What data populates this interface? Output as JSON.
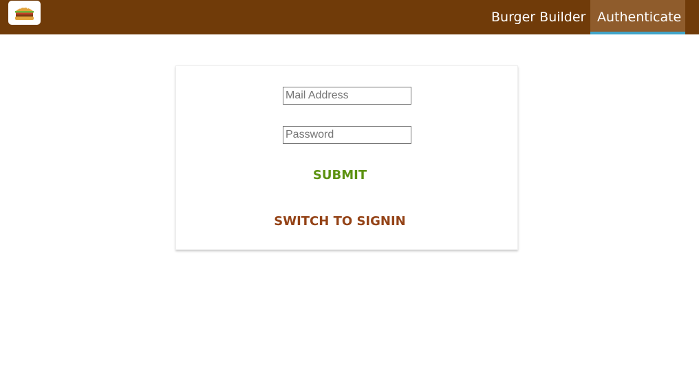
{
  "header": {
    "logo_icon": "burger-icon",
    "nav": {
      "builder_label": "Burger Builder",
      "auth_label": "Authenticate"
    }
  },
  "auth_form": {
    "email_placeholder": "Mail Address",
    "email_value": "",
    "password_placeholder": "Password",
    "password_value": "",
    "submit_label": "SUBMIT",
    "switch_label": "SWITCH TO SIGNIN"
  },
  "colors": {
    "toolbar_bg": "#703b09",
    "active_nav_bg": "#8f5c2c",
    "active_nav_border": "#40a4c8",
    "submit_color": "#5c9210",
    "switch_color": "#944317"
  }
}
